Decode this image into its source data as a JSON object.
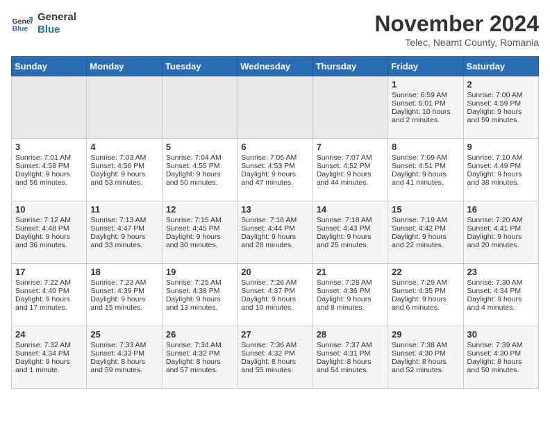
{
  "header": {
    "logo_line1": "General",
    "logo_line2": "Blue",
    "title": "November 2024",
    "subtitle": "Telec, Neamt County, Romania"
  },
  "weekdays": [
    "Sunday",
    "Monday",
    "Tuesday",
    "Wednesday",
    "Thursday",
    "Friday",
    "Saturday"
  ],
  "weeks": [
    [
      {
        "day": "",
        "info": ""
      },
      {
        "day": "",
        "info": ""
      },
      {
        "day": "",
        "info": ""
      },
      {
        "day": "",
        "info": ""
      },
      {
        "day": "",
        "info": ""
      },
      {
        "day": "1",
        "info": "Sunrise: 6:59 AM\nSunset: 5:01 PM\nDaylight: 10 hours and 2 minutes."
      },
      {
        "day": "2",
        "info": "Sunrise: 7:00 AM\nSunset: 4:59 PM\nDaylight: 9 hours and 59 minutes."
      }
    ],
    [
      {
        "day": "3",
        "info": "Sunrise: 7:01 AM\nSunset: 4:58 PM\nDaylight: 9 hours and 56 minutes."
      },
      {
        "day": "4",
        "info": "Sunrise: 7:03 AM\nSunset: 4:56 PM\nDaylight: 9 hours and 53 minutes."
      },
      {
        "day": "5",
        "info": "Sunrise: 7:04 AM\nSunset: 4:55 PM\nDaylight: 9 hours and 50 minutes."
      },
      {
        "day": "6",
        "info": "Sunrise: 7:06 AM\nSunset: 4:53 PM\nDaylight: 9 hours and 47 minutes."
      },
      {
        "day": "7",
        "info": "Sunrise: 7:07 AM\nSunset: 4:52 PM\nDaylight: 9 hours and 44 minutes."
      },
      {
        "day": "8",
        "info": "Sunrise: 7:09 AM\nSunset: 4:51 PM\nDaylight: 9 hours and 41 minutes."
      },
      {
        "day": "9",
        "info": "Sunrise: 7:10 AM\nSunset: 4:49 PM\nDaylight: 9 hours and 38 minutes."
      }
    ],
    [
      {
        "day": "10",
        "info": "Sunrise: 7:12 AM\nSunset: 4:48 PM\nDaylight: 9 hours and 36 minutes."
      },
      {
        "day": "11",
        "info": "Sunrise: 7:13 AM\nSunset: 4:47 PM\nDaylight: 9 hours and 33 minutes."
      },
      {
        "day": "12",
        "info": "Sunrise: 7:15 AM\nSunset: 4:45 PM\nDaylight: 9 hours and 30 minutes."
      },
      {
        "day": "13",
        "info": "Sunrise: 7:16 AM\nSunset: 4:44 PM\nDaylight: 9 hours and 28 minutes."
      },
      {
        "day": "14",
        "info": "Sunrise: 7:18 AM\nSunset: 4:43 PM\nDaylight: 9 hours and 25 minutes."
      },
      {
        "day": "15",
        "info": "Sunrise: 7:19 AM\nSunset: 4:42 PM\nDaylight: 9 hours and 22 minutes."
      },
      {
        "day": "16",
        "info": "Sunrise: 7:20 AM\nSunset: 4:41 PM\nDaylight: 9 hours and 20 minutes."
      }
    ],
    [
      {
        "day": "17",
        "info": "Sunrise: 7:22 AM\nSunset: 4:40 PM\nDaylight: 9 hours and 17 minutes."
      },
      {
        "day": "18",
        "info": "Sunrise: 7:23 AM\nSunset: 4:39 PM\nDaylight: 9 hours and 15 minutes."
      },
      {
        "day": "19",
        "info": "Sunrise: 7:25 AM\nSunset: 4:38 PM\nDaylight: 9 hours and 13 minutes."
      },
      {
        "day": "20",
        "info": "Sunrise: 7:26 AM\nSunset: 4:37 PM\nDaylight: 9 hours and 10 minutes."
      },
      {
        "day": "21",
        "info": "Sunrise: 7:28 AM\nSunset: 4:36 PM\nDaylight: 9 hours and 8 minutes."
      },
      {
        "day": "22",
        "info": "Sunrise: 7:29 AM\nSunset: 4:35 PM\nDaylight: 9 hours and 6 minutes."
      },
      {
        "day": "23",
        "info": "Sunrise: 7:30 AM\nSunset: 4:34 PM\nDaylight: 9 hours and 4 minutes."
      }
    ],
    [
      {
        "day": "24",
        "info": "Sunrise: 7:32 AM\nSunset: 4:34 PM\nDaylight: 9 hours and 1 minute."
      },
      {
        "day": "25",
        "info": "Sunrise: 7:33 AM\nSunset: 4:33 PM\nDaylight: 8 hours and 59 minutes."
      },
      {
        "day": "26",
        "info": "Sunrise: 7:34 AM\nSunset: 4:32 PM\nDaylight: 8 hours and 57 minutes."
      },
      {
        "day": "27",
        "info": "Sunrise: 7:36 AM\nSunset: 4:32 PM\nDaylight: 8 hours and 55 minutes."
      },
      {
        "day": "28",
        "info": "Sunrise: 7:37 AM\nSunset: 4:31 PM\nDaylight: 8 hours and 54 minutes."
      },
      {
        "day": "29",
        "info": "Sunrise: 7:38 AM\nSunset: 4:30 PM\nDaylight: 8 hours and 52 minutes."
      },
      {
        "day": "30",
        "info": "Sunrise: 7:39 AM\nSunset: 4:30 PM\nDaylight: 8 hours and 50 minutes."
      }
    ]
  ]
}
